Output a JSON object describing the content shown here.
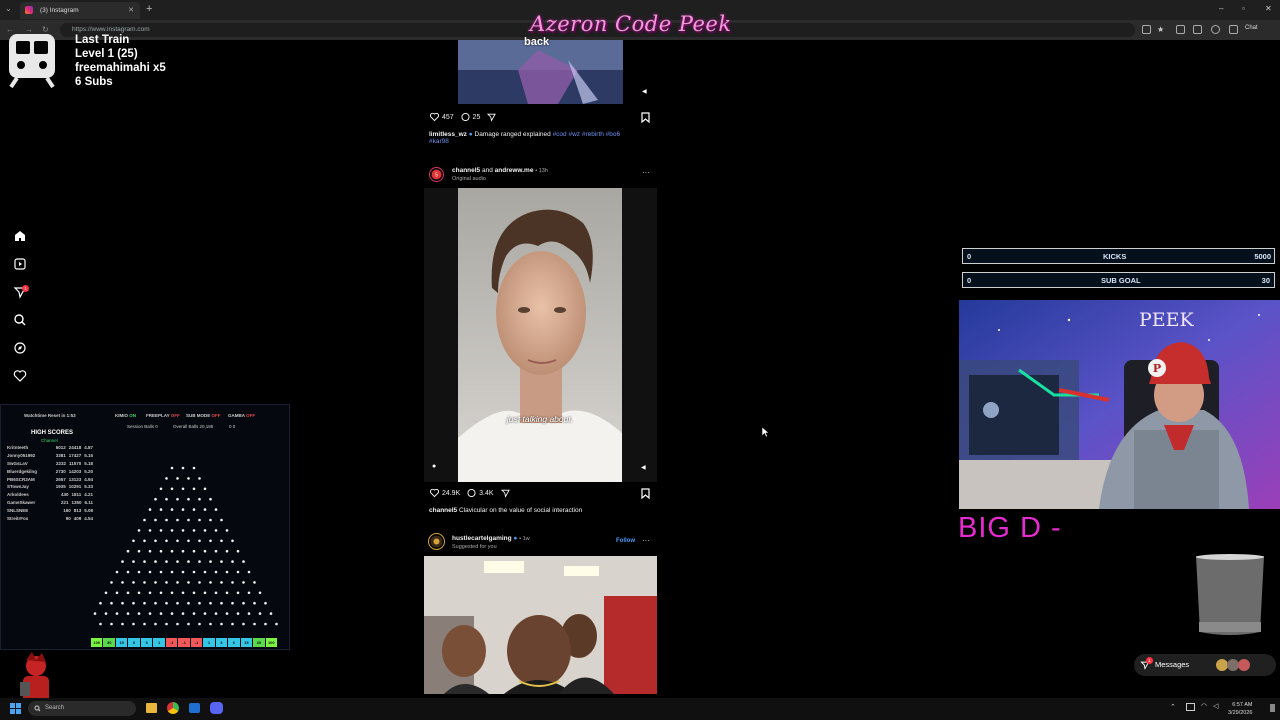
{
  "browser": {
    "tab_title": "(3) Instagram",
    "url": "https://www.instagram.com",
    "chat_label": "Chat"
  },
  "overlay": {
    "title": "Azeron Code Peek",
    "train_lines": [
      "Last Train",
      "Level 1  (25)",
      "freemahimahi x5",
      "6 Subs"
    ],
    "kicks": {
      "start": "0",
      "label": "KICKS",
      "target": "5000",
      "progress": 0
    },
    "sub_goal": {
      "start": "0",
      "label": "SUB GOAL",
      "target": "30",
      "progress": 0
    },
    "cam_label": "PEEK",
    "big_text": "BIG D -"
  },
  "plinko": {
    "watchtime": "Watchtime Reset in 1:53",
    "kimio": "KIMIO",
    "kimio_state": "ON",
    "freeplay": "FREEPLAY",
    "freeplay_state": "OFF",
    "submode": "SUB MODE",
    "submode_state": "OFF",
    "gamba": "GAMBA",
    "gamba_state": "OFF",
    "session_balls": "Session Balls   0",
    "overall_balls": "Overall Balls   20,185",
    "extra": "0   0",
    "high_scores_title": "HIGH SCORES",
    "high_scores_sub": "Channel",
    "scores": [
      [
        "Kritnteeth",
        "5012",
        "24418",
        "4.87"
      ],
      [
        "Jonny051992",
        "3381",
        "17427",
        "5.15"
      ],
      [
        "SwGsLaV",
        "2232",
        "11570",
        "5.18"
      ],
      [
        "Bluerdgekilng",
        "2730",
        "14203",
        "5.20"
      ],
      [
        "PB6SCR3AM",
        "2657",
        "13123",
        "4.94"
      ],
      [
        "STownJay",
        "1935",
        "10291",
        "5.33"
      ],
      [
        "Arkoldees",
        "430",
        "1811",
        "4.21"
      ],
      [
        "GameSkawer",
        "221",
        "1350",
        "6.11"
      ],
      [
        "SNLSNEE",
        "160",
        "813",
        "5.08"
      ],
      [
        "StreitrFox",
        "90",
        "409",
        "4.54"
      ]
    ],
    "bins": [
      "100",
      "30",
      "15",
      "6",
      "3",
      "1",
      "-1",
      "-1",
      "-1",
      "1",
      "3",
      "6",
      "15",
      "30",
      "100"
    ],
    "bin_colors": [
      "#7cf542",
      "#5ad94a",
      "#35c6e6",
      "#35c6e6",
      "#35c6e6",
      "#35c6e6",
      "#f25858",
      "#f25858",
      "#f25858",
      "#35c6e6",
      "#35c6e6",
      "#35c6e6",
      "#35c6e6",
      "#5ad94a",
      "#7cf542"
    ]
  },
  "feed": {
    "post1": {
      "overlay_word": "back",
      "likes": "457",
      "comments": "25",
      "username": "limitless_wz",
      "caption": "Damage ranged explained",
      "hashtags": "#cod #wz #rebirth #bo6",
      "hashtags2": "#kar98"
    },
    "post2": {
      "author": "channel5",
      "joiner": "and",
      "coauthor": "andreww.me",
      "time": "• 13h",
      "audio": "Original audio",
      "subtitle": "just talking about.",
      "likes": "24.9K",
      "comments": "3.4K",
      "username": "channel5",
      "caption": "Clavicular on the value of social interaction"
    },
    "post3": {
      "author": "hustlecartelgaming",
      "time": "• 1w",
      "suggested": "Suggested for you",
      "follow": "Follow"
    }
  },
  "messages_label": "Messages",
  "messages_badge": "1",
  "notif_badge": "1",
  "taskbar": {
    "search_placeholder": "Search",
    "time": "6:57 AM",
    "date": "3/29/2026"
  }
}
